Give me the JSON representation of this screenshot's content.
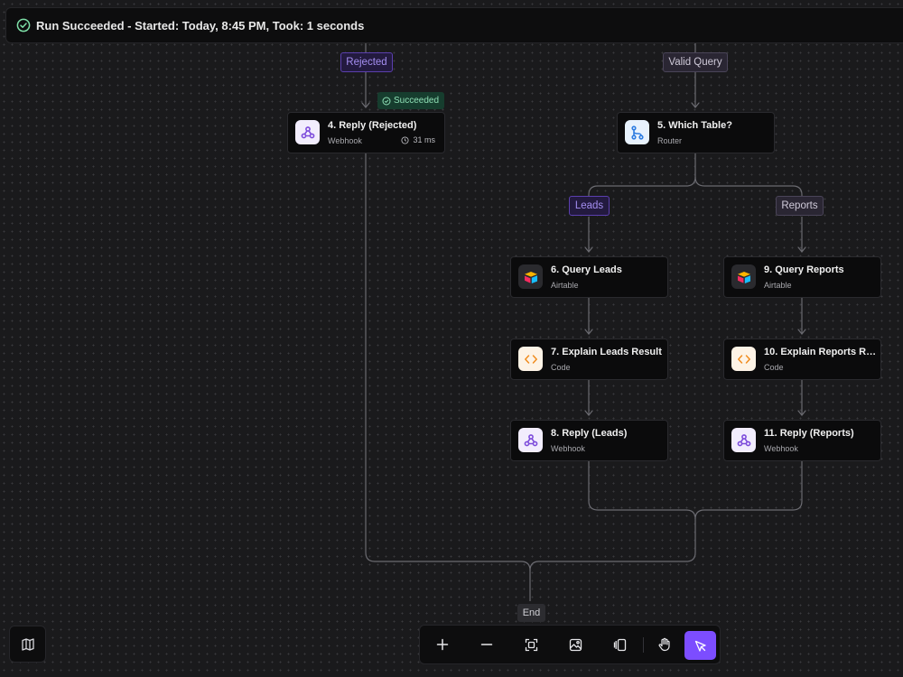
{
  "status": {
    "text": "Run Succeeded - Started: Today, 8:45 PM, Took: 1 seconds",
    "icon": "check-circle-icon",
    "color": "#7ee0a8"
  },
  "branches": {
    "rejected": "Rejected",
    "valid_query": "Valid Query",
    "leads": "Leads",
    "reports": "Reports"
  },
  "badge": {
    "succeeded": "Succeeded"
  },
  "nodes": {
    "reply_rejected": {
      "title": "4. Reply (Rejected)",
      "subtitle": "Webhook",
      "duration": "31 ms",
      "icon": "webhook-icon"
    },
    "which_table": {
      "title": "5. Which Table?",
      "subtitle": "Router",
      "icon": "router-icon"
    },
    "query_leads": {
      "title": "6. Query Leads",
      "subtitle": "Airtable",
      "icon": "airtable-icon"
    },
    "explain_leads": {
      "title": "7. Explain Leads Result",
      "subtitle": "Code",
      "icon": "code-icon"
    },
    "reply_leads": {
      "title": "8. Reply (Leads)",
      "subtitle": "Webhook",
      "icon": "webhook-icon"
    },
    "query_reports": {
      "title": "9. Query Reports",
      "subtitle": "Airtable",
      "icon": "airtable-icon"
    },
    "explain_reports": {
      "title": "10. Explain Reports Re...",
      "subtitle": "Code",
      "icon": "code-icon"
    },
    "reply_reports": {
      "title": "11. Reply (Reports)",
      "subtitle": "Webhook",
      "icon": "webhook-icon"
    }
  },
  "end": "End",
  "toolbar": {
    "buttons": [
      "zoom-in-icon",
      "zoom-out-icon",
      "fit-view-icon",
      "export-image-icon",
      "layout-icon",
      "hand-pan-icon",
      "select-pointer-icon"
    ],
    "active": "select-pointer-icon",
    "accent": "#7c4dff"
  },
  "colors": {
    "canvas": "#1a1a1c",
    "node_bg": "#0b0b0c",
    "branch_accent": "#a48ef0",
    "success": "#163d2e"
  }
}
